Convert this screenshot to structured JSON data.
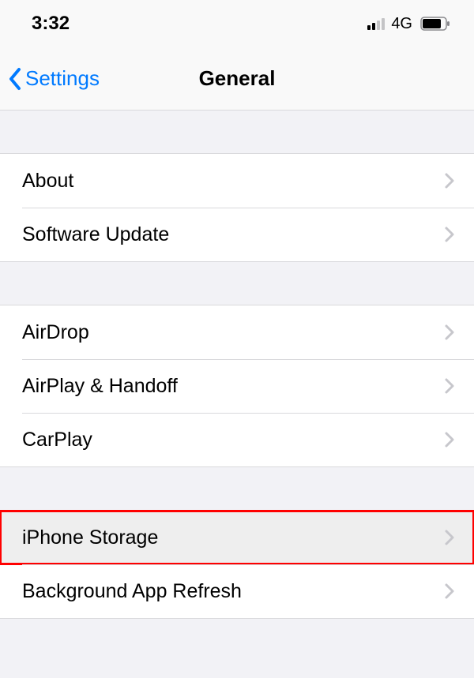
{
  "statusbar": {
    "time": "3:32",
    "network": "4G"
  },
  "nav": {
    "back_label": "Settings",
    "title": "General"
  },
  "groups": {
    "g1": {
      "about": "About",
      "software_update": "Software Update"
    },
    "g2": {
      "airdrop": "AirDrop",
      "airplay_handoff": "AirPlay & Handoff",
      "carplay": "CarPlay"
    },
    "g3": {
      "iphone_storage": "iPhone Storage",
      "background_app_refresh": "Background App Refresh"
    }
  }
}
